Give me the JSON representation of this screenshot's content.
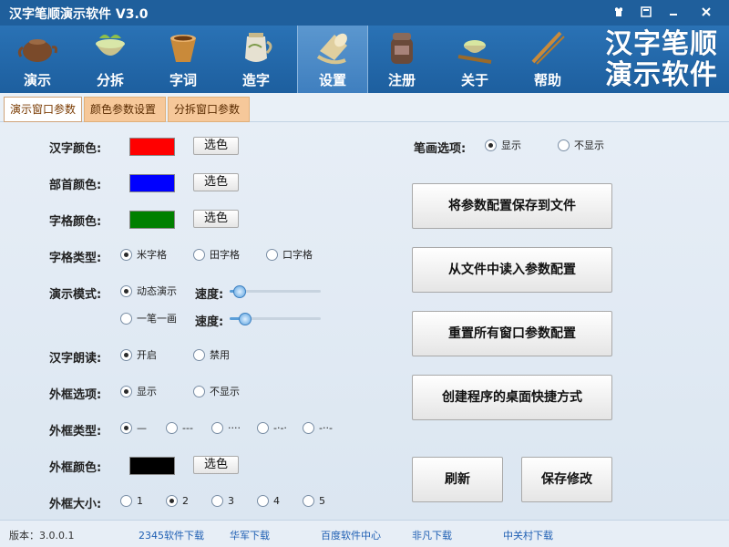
{
  "window": {
    "title": "汉字笔顺演示软件 V3.0",
    "controls": [
      "shirt-icon",
      "skin-icon",
      "minimize-icon",
      "close-icon"
    ]
  },
  "toolbar": {
    "items": [
      {
        "label": "演示",
        "icon": "teapot-icon"
      },
      {
        "label": "分拆",
        "icon": "tea-bowl-icon"
      },
      {
        "label": "字词",
        "icon": "cup-icon"
      },
      {
        "label": "造字",
        "icon": "jug-icon"
      },
      {
        "label": "设置",
        "icon": "tipped-cup-icon",
        "active": true
      },
      {
        "label": "注册",
        "icon": "tea-jar-icon"
      },
      {
        "label": "关于",
        "icon": "tea-tray-icon"
      },
      {
        "label": "帮助",
        "icon": "tea-scoop-icon"
      }
    ],
    "brand_line1": "汉字笔顺",
    "brand_line2": "演示软件"
  },
  "tabs": [
    {
      "label": "演示窗口参数",
      "active": true
    },
    {
      "label": "颜色参数设置",
      "active": false
    },
    {
      "label": "分拆窗口参数",
      "active": false
    }
  ],
  "settings": {
    "hanzi_color_label": "汉字颜色:",
    "hanzi_color": "#ff0000",
    "radical_color_label": "部首颜色:",
    "radical_color": "#0000ff",
    "grid_color_label": "字格颜色:",
    "grid_color": "#008000",
    "pick_label": "选色",
    "grid_type_label": "字格类型:",
    "grid_types": [
      "米字格",
      "田字格",
      "口字格"
    ],
    "demo_mode_label": "演示模式:",
    "demo_modes": [
      "动态演示",
      "一笔一画"
    ],
    "speed_label": "速度:",
    "speed_dynamic": 0.05,
    "speed_stroke": 0.12,
    "read_label": "汉字朗读:",
    "read_options": [
      "开启",
      "禁用"
    ],
    "frame_option_label": "外框选项:",
    "frame_options": [
      "显示",
      "不显示"
    ],
    "frame_type_label": "外框类型:",
    "frame_types": [
      "—",
      "---",
      "····",
      "-·-·",
      "-··-"
    ],
    "frame_color_label": "外框颜色:",
    "frame_color": "#000000",
    "frame_size_label": "外框大小:",
    "frame_sizes": [
      "1",
      "2",
      "3",
      "4",
      "5"
    ],
    "stroke_option_label": "笔画选项:",
    "stroke_options": [
      "显示",
      "不显示"
    ]
  },
  "actions": {
    "save_to_file": "将参数配置保存到文件",
    "load_from_file": "从文件中读入参数配置",
    "reset_all": "重置所有窗口参数配置",
    "create_shortcut": "创建程序的桌面快捷方式",
    "refresh": "刷新",
    "save_changes": "保存修改"
  },
  "statusbar": {
    "version": "版本：3.0.0.1",
    "links": [
      "2345软件下载",
      "华军下载",
      "百度软件中心",
      "非凡下载",
      "中关村下载"
    ]
  }
}
